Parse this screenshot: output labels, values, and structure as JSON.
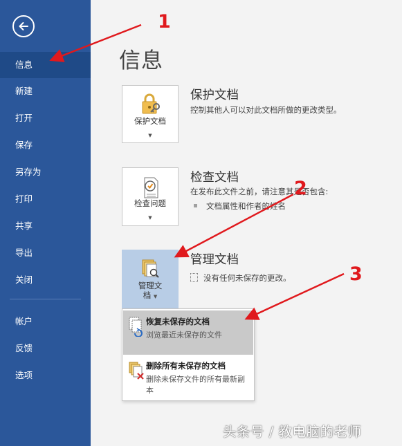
{
  "sidebar": {
    "back_label": "back",
    "items": [
      {
        "label": "信息"
      },
      {
        "label": "新建"
      },
      {
        "label": "打开"
      },
      {
        "label": "保存"
      },
      {
        "label": "另存为"
      },
      {
        "label": "打印"
      },
      {
        "label": "共享"
      },
      {
        "label": "导出"
      },
      {
        "label": "关闭"
      },
      {
        "label": "帐户"
      },
      {
        "label": "反馈"
      },
      {
        "label": "选项"
      }
    ]
  },
  "page": {
    "title": "信息"
  },
  "protect": {
    "button_label": "保护文档",
    "title": "保护文档",
    "desc": "控制其他人可以对此文档所做的更改类型。"
  },
  "inspect": {
    "button_label": "检查问题",
    "title": "检查文档",
    "desc": "在发布此文件之前，请注意其是否包含:",
    "bullets": [
      "文档属性和作者的姓名"
    ]
  },
  "manage": {
    "button_label_1": "管理文",
    "button_label_2": "档",
    "title": "管理文档",
    "desc": "没有任何未保存的更改。"
  },
  "dropdown": {
    "items": [
      {
        "title": "恢复未保存的文档",
        "desc": "浏览最近未保存的文件"
      },
      {
        "title": "删除所有未保存的文档",
        "desc": "删除未保存文件的所有最新副本"
      }
    ]
  },
  "annotations": {
    "n1": "1",
    "n2": "2",
    "n3": "3",
    "color": "#e0191d"
  },
  "watermark": "头条号 / 教电脑的老师",
  "colors": {
    "sidebar": "#2b579a",
    "sidebar_active": "#1f4a87",
    "highlight": "#b8cde6"
  }
}
